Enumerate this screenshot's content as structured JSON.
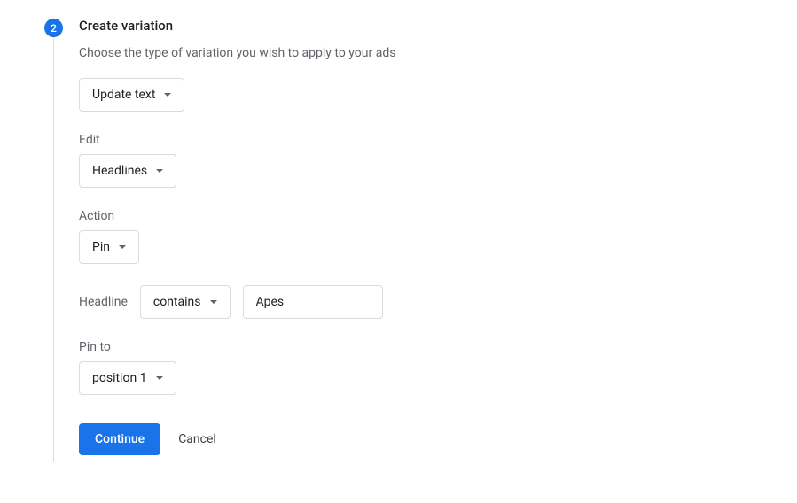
{
  "step": {
    "number": "2",
    "title": "Create variation",
    "description": "Choose the type of variation you wish to apply to your ads"
  },
  "variationType": {
    "value": "Update text"
  },
  "edit": {
    "label": "Edit",
    "value": "Headlines"
  },
  "action": {
    "label": "Action",
    "value": "Pin"
  },
  "headline": {
    "label": "Headline",
    "operator": "contains",
    "text": "Apes"
  },
  "pinTo": {
    "label": "Pin to",
    "value": "position 1"
  },
  "buttons": {
    "continue": "Continue",
    "cancel": "Cancel"
  }
}
